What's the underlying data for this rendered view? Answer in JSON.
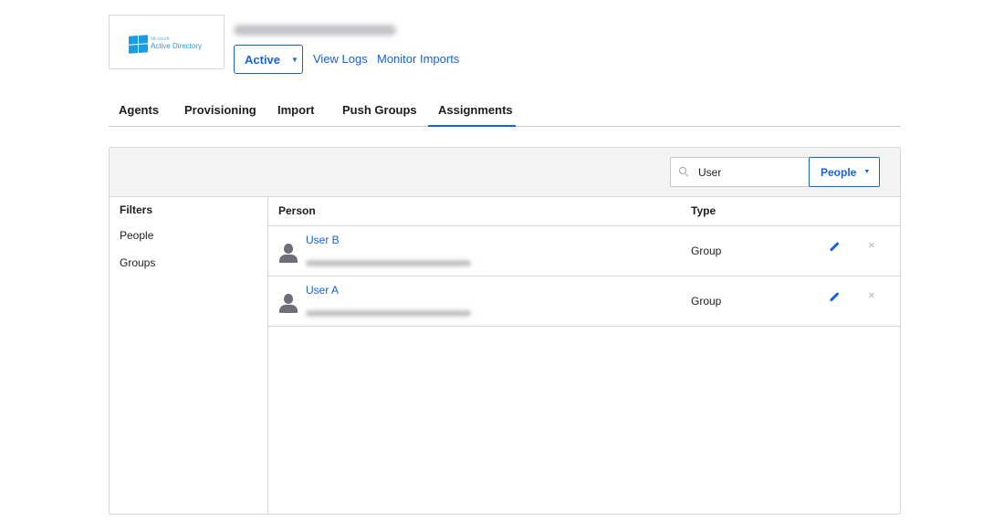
{
  "header": {
    "logo_prefix": "Microsoft",
    "logo_name": "Active Directory",
    "status_label": "Active",
    "links": [
      "View Logs",
      "Monitor Imports"
    ]
  },
  "tabs": [
    {
      "label": "Agents"
    },
    {
      "label": "Provisioning"
    },
    {
      "label": "Import"
    },
    {
      "label": "Push Groups"
    },
    {
      "label": "Assignments",
      "active": true
    }
  ],
  "toolbar": {
    "search_value": "User",
    "filter_button": "People"
  },
  "filters": {
    "title": "Filters",
    "items": [
      "People",
      "Groups"
    ]
  },
  "table": {
    "columns": [
      "Person",
      "Type"
    ],
    "rows": [
      {
        "name": "User B",
        "type": "Group"
      },
      {
        "name": "User A",
        "type": "Group"
      }
    ]
  },
  "icons": {
    "remove": "×"
  },
  "colors": {
    "accent": "#1662dd",
    "logo_blue": "#1a9ce5"
  }
}
